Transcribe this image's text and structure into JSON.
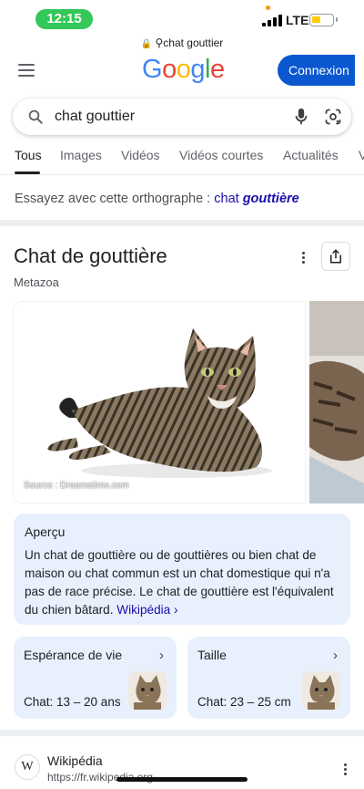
{
  "status_bar": {
    "time": "12:15",
    "network": "LTE"
  },
  "browser": {
    "url_text": "chat gouttier"
  },
  "header": {
    "logo_letters": [
      {
        "ch": "G",
        "cls": "b"
      },
      {
        "ch": "o",
        "cls": "r"
      },
      {
        "ch": "o",
        "cls": "y"
      },
      {
        "ch": "g",
        "cls": "b"
      },
      {
        "ch": "l",
        "cls": "g"
      },
      {
        "ch": "e",
        "cls": "r"
      }
    ],
    "signin_label": "Connexion"
  },
  "search": {
    "query": "chat gouttier"
  },
  "tabs": [
    "Tous",
    "Images",
    "Vidéos",
    "Vidéos courtes",
    "Actualités",
    "V"
  ],
  "spelling": {
    "prefix": "Essayez avec cette orthographe : ",
    "word1": "chat",
    "word2": "gouttière"
  },
  "knowledge_panel": {
    "title": "Chat de gouttière",
    "subtitle": "Metazoa",
    "image_source": "Source : Dreamstime.com",
    "overview": {
      "heading": "Aperçu",
      "text": "Un chat de gouttière ou de gouttières ou bien chat de maison ou chat commun est un chat domestique qui n'a pas de race précise. Le chat de gouttière est l'équivalent du chien bâtard. ",
      "link": "Wikipédia ›"
    },
    "cards": [
      {
        "title": "Espérance de vie",
        "value": "Chat: 13 – 20 ans"
      },
      {
        "title": "Taille",
        "value": "Chat: 23 – 25 cm"
      }
    ]
  },
  "result": {
    "site": "Wikipédia",
    "url": "https://fr.wikipedia.org"
  },
  "colors": {
    "accent": "#0b57d0",
    "link": "#1a0dab",
    "card_bg": "#e8f0fe"
  }
}
